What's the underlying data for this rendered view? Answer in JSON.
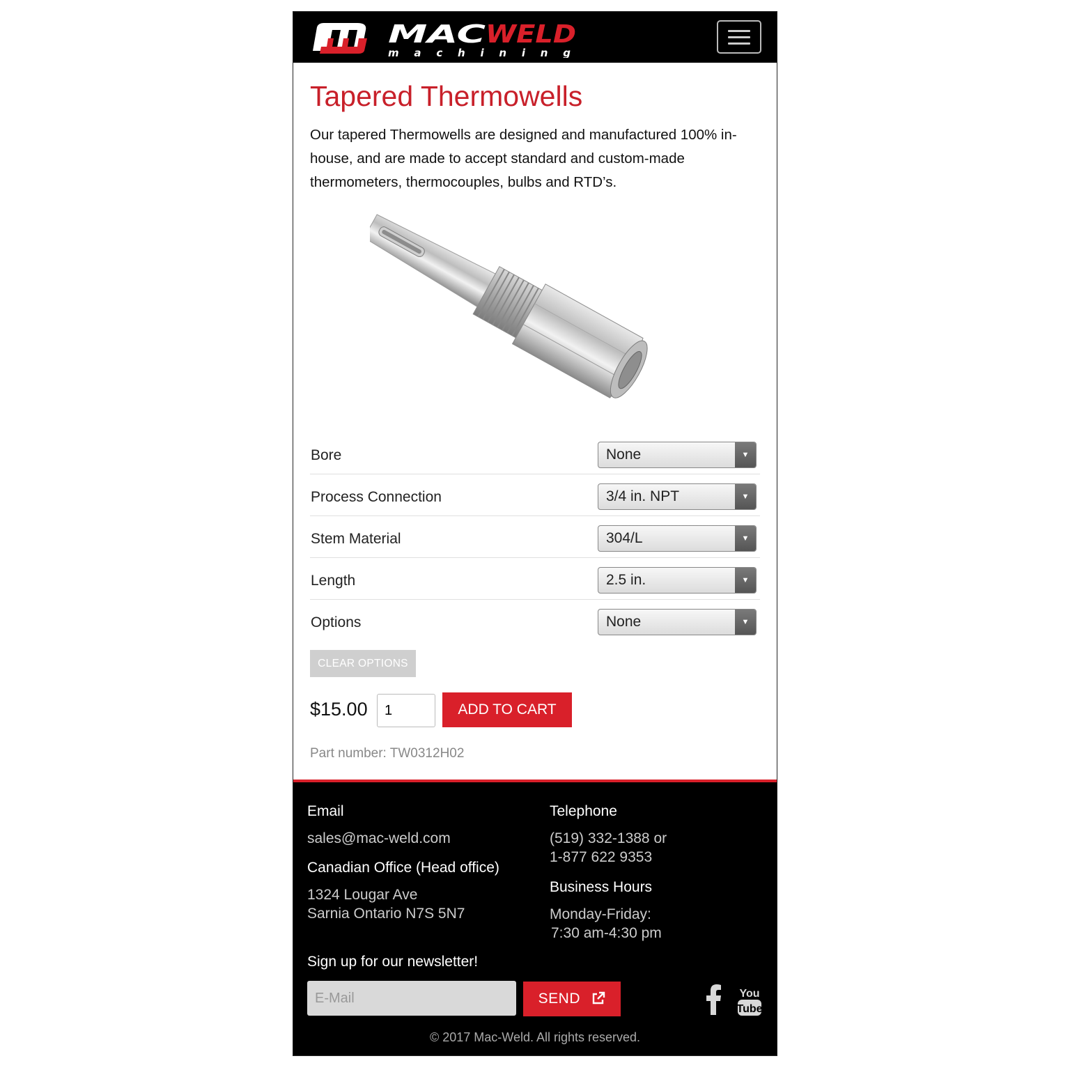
{
  "brand": {
    "name": "MACWELD",
    "name_part1": "MAC",
    "name_part2": "WELD",
    "tagline": "m a c h i n i n g",
    "red": "#d9202a",
    "title_red": "#c8202a"
  },
  "header": {
    "menu_icon": "hamburger-menu-icon"
  },
  "page": {
    "title": "Tapered Thermowells",
    "intro": "Our tapered Thermowells are designed and manufactured 100% in-house, and are made to accept standard and custom-made thermometers, thermocouples, bulbs and RTD’s."
  },
  "options": [
    {
      "label": "Bore",
      "value": "None"
    },
    {
      "label": "Process Connection",
      "value": "3/4 in. NPT"
    },
    {
      "label": "Stem Material",
      "value": "304/L"
    },
    {
      "label": "Length",
      "value": "2.5 in."
    },
    {
      "label": "Options",
      "value": "None"
    }
  ],
  "clear_label": "CLEAR OPTIONS",
  "price": "$15.00",
  "quantity": "1",
  "add_to_cart": "ADD TO CART",
  "part_number": "Part number: TW0312H02",
  "footer": {
    "email_heading": "Email",
    "email": "sales@mac-weld.com",
    "office_heading": "Canadian Office (Head office)",
    "address_line1": "1324 Lougar Ave",
    "address_line2": "Sarnia Ontario  N7S 5N7",
    "phone_heading": "Telephone",
    "phone1": "(519) 332-1388 or",
    "phone2": "1-877 622 9353",
    "hours_heading": "Business Hours",
    "hours1": "Monday-Friday:",
    "hours2": "7:30 am-4:30 pm",
    "newsletter_heading": "Sign up for our newsletter!",
    "newsletter_placeholder": "E-Mail",
    "send_label": "SEND",
    "youtube_top": "You",
    "youtube_bottom": "Tube",
    "copyright": "© 2017 Mac-Weld. All rights reserved."
  }
}
